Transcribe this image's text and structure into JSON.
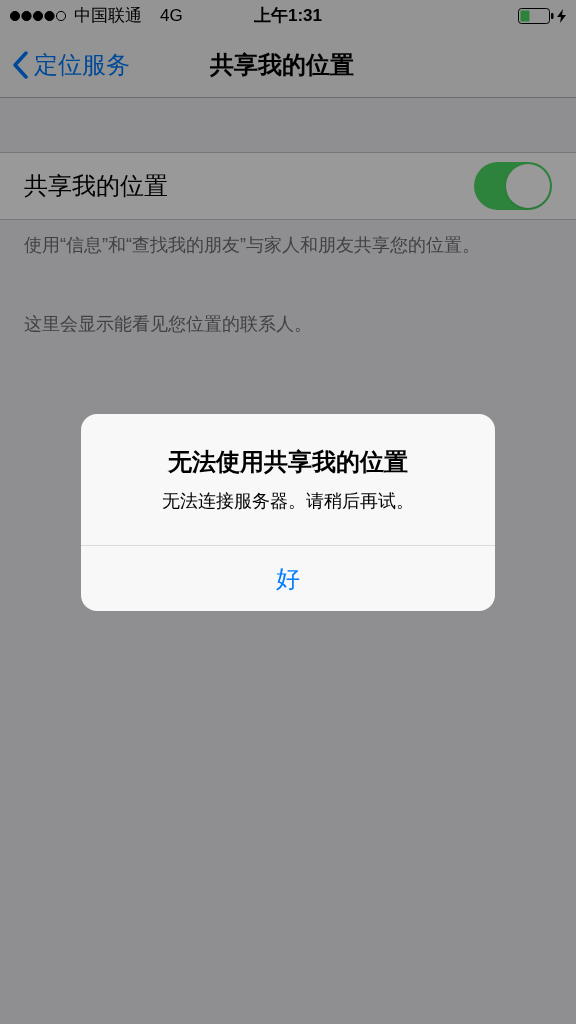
{
  "status_bar": {
    "carrier": "中国联通",
    "network": "4G",
    "time": "上午1:31",
    "charging": true
  },
  "nav": {
    "back": "定位服务",
    "title": "共享我的位置"
  },
  "setting": {
    "label": "共享我的位置",
    "on": true
  },
  "notes": [
    "使用“信息”和“查找我的朋友”与家人和朋友共享您的位置。",
    "这里会显示能看见您位置的联系人。"
  ],
  "alert": {
    "title": "无法使用共享我的位置",
    "message": "无法连接服务器。请稍后再试。",
    "buttons": [
      "好"
    ]
  }
}
